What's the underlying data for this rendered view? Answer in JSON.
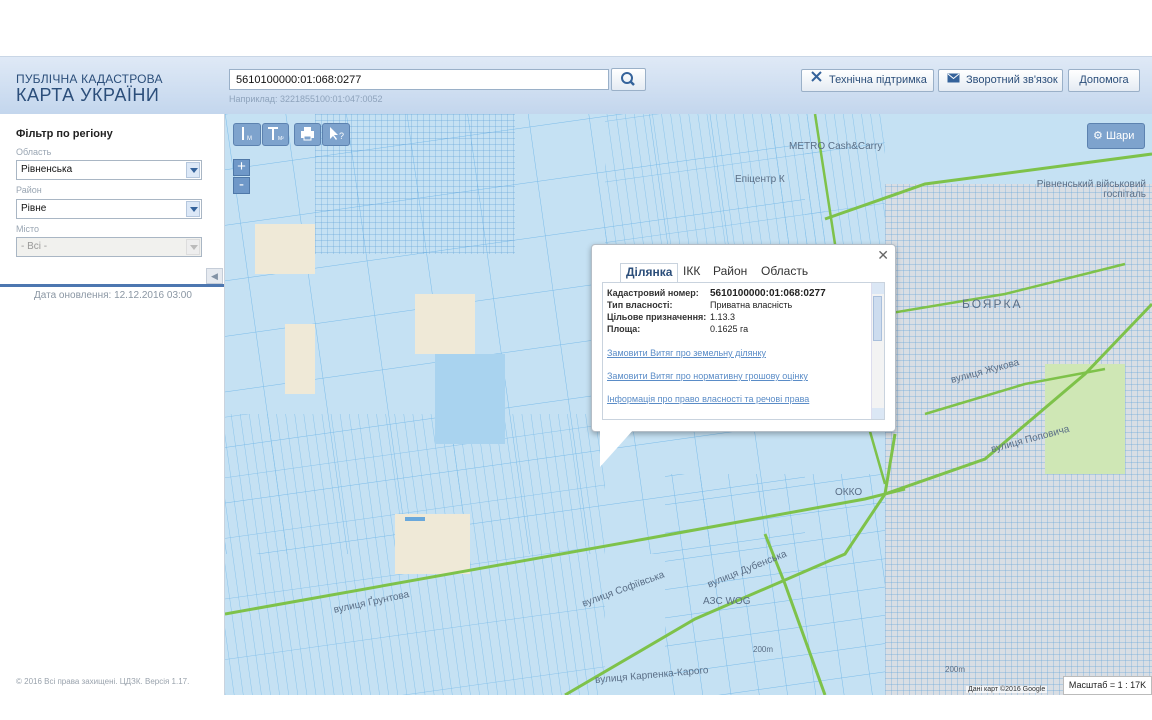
{
  "header": {
    "logo_line1": "ПУБЛІЧНА КАДАСТРОВА",
    "logo_line2": "КАРТА УКРАЇНИ",
    "search_value": "5610100000:01:068:0277",
    "search_hint": "Наприклад: 3221855100:01:047:0052",
    "support_label": "Технічна підтримка",
    "feedback_label": "Зворотний зв'язок",
    "help_label": "Допомога"
  },
  "sidebar": {
    "filter_title": "Фільтр по регіону",
    "oblast_label": "Область",
    "oblast_value": "Рівненська",
    "rayon_label": "Район",
    "rayon_value": "Рівне",
    "city_label": "Місто",
    "city_value": "- Всі -",
    "update_date": "Дата оновлення: 12.12.2016 03:00",
    "copyright": "© 2016 Всі права захищені. ЦДЗК. Версія 1.17."
  },
  "map": {
    "layers_label": "Шари",
    "zoom_in": "+",
    "zoom_out": "-",
    "scale": "Масштаб = 1 : 17K",
    "attribution": "Дані карт ©2016 Google",
    "labels": {
      "metro": "METRO Cash&Carry",
      "epicentr": "Епіцентр К",
      "hospital": "Рівненський військовий госпіталь",
      "boyarka": "БОЯРКА",
      "okko": "ОККО",
      "azs": "АЗС WOG",
      "sofiivska": "вулиця Софіївська",
      "dubenska": "вулиця Дубенська",
      "gruntova": "вулиця Ґрунтова",
      "zhukova": "вулиця Жукова",
      "popovycha": "вулиця Поповича",
      "karpenka": "вулиця Карпенка-Карого",
      "elev1": "200m",
      "elev2": "200m"
    }
  },
  "popup": {
    "tabs": [
      "Ділянка",
      "ІКК",
      "Район",
      "Область"
    ],
    "active_tab": "Ділянка",
    "rows": [
      {
        "key": "Кадастровий номер:",
        "value": "5610100000:01:068:0277"
      },
      {
        "key": "Тип власності:",
        "value": "Приватна власність"
      },
      {
        "key": "Цільове призначення:",
        "value": "1.13.3"
      },
      {
        "key": "Площа:",
        "value": "0.1625 га"
      }
    ],
    "links": [
      "Замовити Витяг про земельну ділянку",
      "Замовити Витяг про нормативну грошову оцінку",
      "Інформація про право власності та речові права"
    ]
  },
  "colors": {
    "header_blue": "#2b4e7a",
    "parcel_line": "#6fb4e6",
    "road_green": "#7ec24a",
    "link_blue": "#5a8cc7"
  }
}
